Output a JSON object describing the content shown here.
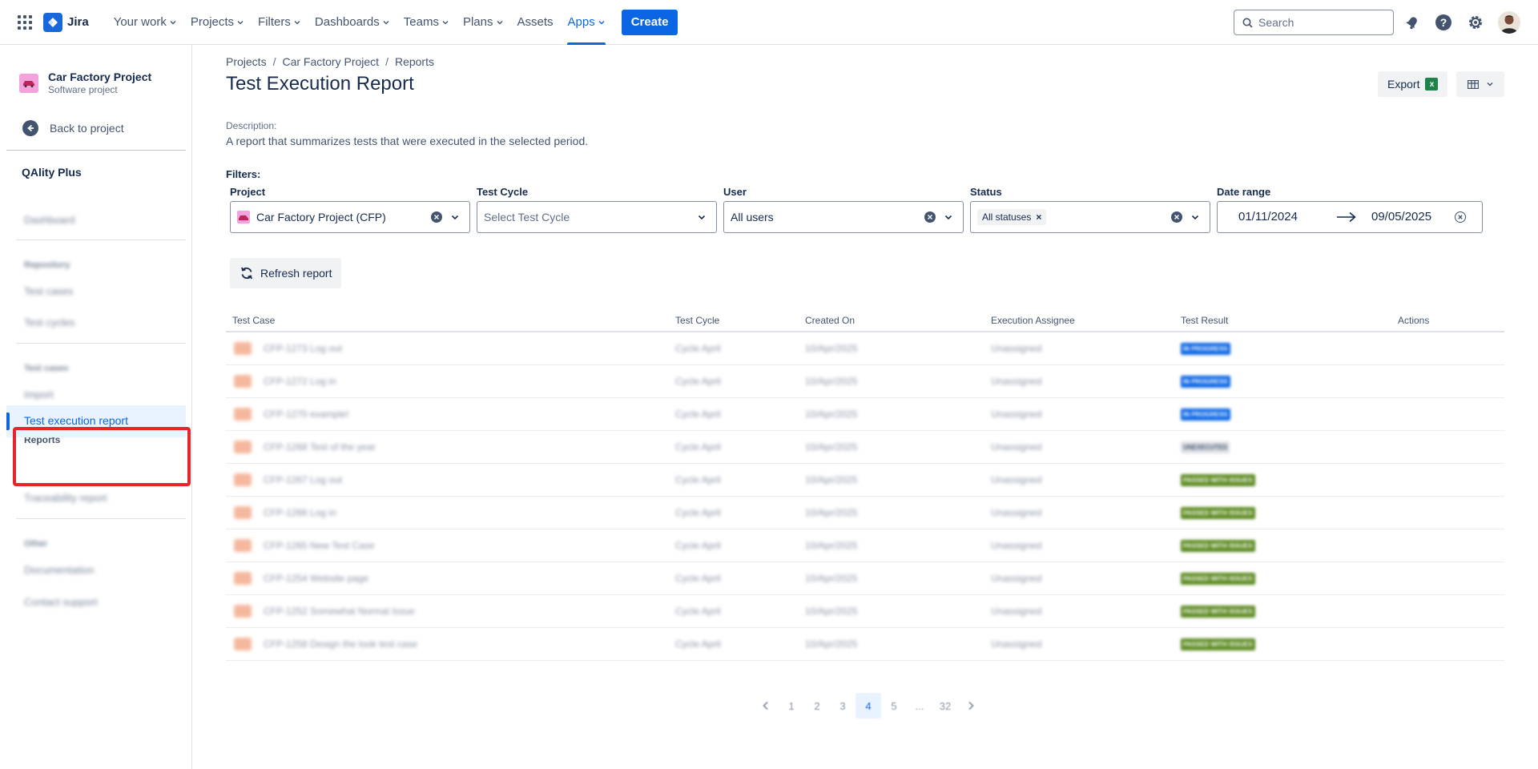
{
  "topnav": {
    "logo": "Jira",
    "items": [
      {
        "label": "Your work",
        "active": false
      },
      {
        "label": "Projects",
        "active": false
      },
      {
        "label": "Filters",
        "active": false
      },
      {
        "label": "Dashboards",
        "active": false
      },
      {
        "label": "Teams",
        "active": false
      },
      {
        "label": "Plans",
        "active": false
      },
      {
        "label": "Assets",
        "active": false,
        "no_chevron": true
      },
      {
        "label": "Apps",
        "active": true
      }
    ],
    "create": "Create",
    "search_placeholder": "Search",
    "icons": [
      "notifications-icon",
      "help-icon",
      "settings-icon",
      "avatar"
    ]
  },
  "sidebar": {
    "project_name": "Car Factory Project",
    "project_type": "Software project",
    "back": "Back to project",
    "app_title": "QAlity Plus",
    "dashboard": "Dashboard",
    "repository_head": "Repository",
    "test_cases": "Test cases",
    "test_cycles": "Test cycles",
    "testcases_head": "Test cases",
    "import": "Import",
    "reports_head": "Reports",
    "test_execution_report": "Test execution report",
    "traceability_report": "Traceability report",
    "other_head": "Other",
    "documentation": "Documentation",
    "contact_support": "Contact support"
  },
  "breadcrumb": [
    "Projects",
    "Car Factory Project",
    "Reports"
  ],
  "page": {
    "title": "Test Execution Report",
    "export": "Export",
    "desc_label": "Description:",
    "desc_text": "A report that summarizes tests that were executed in the selected period.",
    "filters_label": "Filters:",
    "refresh": "Refresh report"
  },
  "filters": {
    "project": {
      "label": "Project",
      "value": "Car Factory Project (CFP)"
    },
    "test_cycle": {
      "label": "Test Cycle",
      "placeholder": "Select Test Cycle"
    },
    "user": {
      "label": "User",
      "value": "All users"
    },
    "status": {
      "label": "Status",
      "tag": "All statuses"
    },
    "date_range": {
      "label": "Date range",
      "from": "01/11/2024",
      "to": "09/05/2025"
    }
  },
  "table": {
    "headers": [
      "Test Case",
      "Test Cycle",
      "Created On",
      "Execution Assignee",
      "Test Result",
      "Actions"
    ],
    "rows": [
      {
        "key": "CFP-1273",
        "name": "Log out",
        "cycle": "Cycle April",
        "created": "10/Apr/2025",
        "assignee": "Unassigned",
        "result": "IN PROGRESS",
        "status": "inprog"
      },
      {
        "key": "CFP-1272",
        "name": "Log in",
        "cycle": "Cycle April",
        "created": "10/Apr/2025",
        "assignee": "Unassigned",
        "result": "IN PROGRESS",
        "status": "inprog"
      },
      {
        "key": "CFP-1270",
        "name": "example!",
        "cycle": "Cycle April",
        "created": "10/Apr/2025",
        "assignee": "Unassigned",
        "result": "IN PROGRESS",
        "status": "inprog"
      },
      {
        "key": "CFP-1268",
        "name": "Test of the year",
        "cycle": "Cycle April",
        "created": "10/Apr/2025",
        "assignee": "Unassigned",
        "result": "UNEXECUTED",
        "status": "unexec"
      },
      {
        "key": "CFP-1267",
        "name": "Log out",
        "cycle": "Cycle April",
        "created": "10/Apr/2025",
        "assignee": "Unassigned",
        "result": "PASSED WITH ISSUES",
        "status": "passed"
      },
      {
        "key": "CFP-1266",
        "name": "Log in",
        "cycle": "Cycle April",
        "created": "10/Apr/2025",
        "assignee": "Unassigned",
        "result": "PASSED WITH ISSUES",
        "status": "passed"
      },
      {
        "key": "CFP-1265",
        "name": "New Test Case",
        "cycle": "Cycle April",
        "created": "10/Apr/2025",
        "assignee": "Unassigned",
        "result": "PASSED WITH ISSUES",
        "status": "passed"
      },
      {
        "key": "CFP-1254",
        "name": "Website page",
        "cycle": "Cycle April",
        "created": "10/Apr/2025",
        "assignee": "Unassigned",
        "result": "PASSED WITH ISSUES",
        "status": "passed"
      },
      {
        "key": "CFP-1252",
        "name": "Somewhat Normal Issue",
        "cycle": "Cycle April",
        "created": "10/Apr/2025",
        "assignee": "Unassigned",
        "result": "PASSED WITH ISSUES",
        "status": "passed"
      },
      {
        "key": "CFP-1258",
        "name": "Design the look test case",
        "cycle": "Cycle April",
        "created": "10/Apr/2025",
        "assignee": "Unassigned",
        "result": "PASSED WITH ISSUES",
        "status": "passed"
      }
    ]
  },
  "pagination": {
    "pages": [
      "1",
      "2",
      "3",
      "4",
      "5",
      "...",
      "32"
    ],
    "current": "4"
  },
  "colors": {
    "accent": "#0c66e4",
    "highlight": "#e5252a",
    "passed": "#5b8a1f",
    "in_progress": "#0c66e4"
  }
}
